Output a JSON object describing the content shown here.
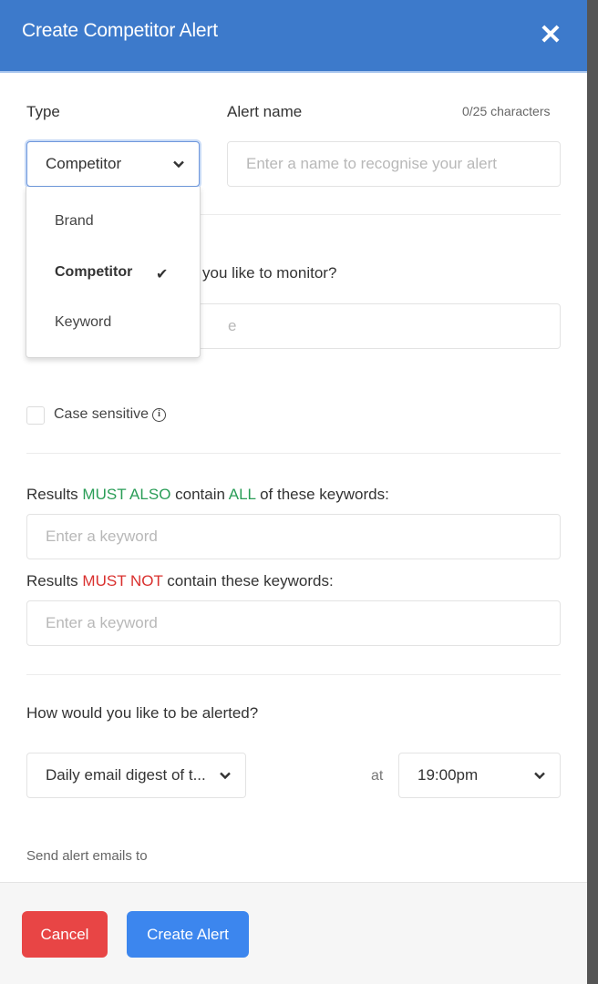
{
  "header": {
    "title": "Create Competitor Alert",
    "close_icon": "close-icon"
  },
  "type_field": {
    "label": "Type",
    "selected": "Competitor",
    "options": [
      {
        "label": "Brand",
        "selected": false
      },
      {
        "label": "Competitor",
        "selected": true
      },
      {
        "label": "Keyword",
        "selected": false
      }
    ],
    "check_glyph": "✔"
  },
  "alert_name": {
    "label": "Alert name",
    "counter": "0/25 characters",
    "placeholder": "Enter a name to recognise your alert",
    "value": ""
  },
  "monitor": {
    "question_visible": "you like to monitor?",
    "placeholder_visible": "e"
  },
  "case_sensitive": {
    "label": "Case sensitive",
    "checked": false,
    "info_glyph": "i"
  },
  "must_also": {
    "prefix": "Results ",
    "highlight1": "MUST ALSO",
    "middle": " contain ",
    "highlight2": "ALL",
    "suffix": " of these keywords:",
    "placeholder": "Enter a keyword",
    "highlight_color": "#2a9d57"
  },
  "must_not": {
    "prefix": "Results ",
    "highlight": "MUST NOT",
    "suffix": " contain these keywords:",
    "placeholder": "Enter a keyword",
    "highlight_color": "#d9302e"
  },
  "alerting": {
    "question": "How would you like to be alerted?",
    "frequency": "Daily email digest of t...",
    "at_label": "at",
    "time": "19:00pm",
    "send_to_label": "Send alert emails to"
  },
  "footer": {
    "cancel": "Cancel",
    "create": "Create Alert"
  },
  "colors": {
    "header": "#3d7acb",
    "cancel": "#e84545",
    "create": "#3c86ee"
  }
}
